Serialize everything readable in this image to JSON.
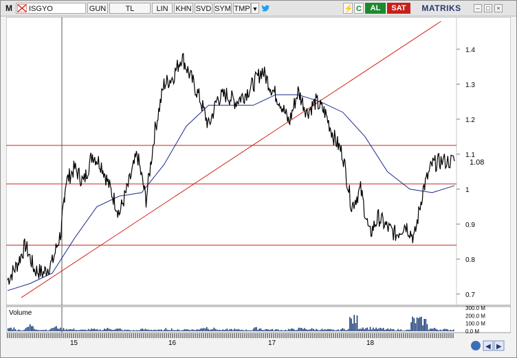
{
  "toolbar": {
    "logo": "M",
    "symbol": "ISGYO",
    "buttons": [
      "GUN",
      "TL",
      "LIN",
      "KHN",
      "SVD",
      "SYM",
      "TMP"
    ],
    "buy_label": "AL",
    "sell_label": "SAT",
    "brand": "MATRIKS",
    "icons": [
      "arrow-down-icon",
      "twitter-icon",
      "lightning-icon",
      "refresh-icon"
    ],
    "window_icons": [
      "minimize-icon",
      "restore-icon",
      "close-icon"
    ]
  },
  "price_panel": {
    "y_ticks": [
      "1.4",
      "1.3",
      "1.2",
      "1.1",
      "1",
      "0.9",
      "0.8",
      "0.7"
    ],
    "current_price": "1.08",
    "colors": {
      "price": "#000000",
      "moving_average": "#1a2a8c",
      "trendline": "#d0201a",
      "levels": "#c8261e",
      "axis_price_label": "#000000"
    }
  },
  "volume_panel": {
    "label": "Volume",
    "y_ticks": [
      "300.0 M",
      "200.0 M",
      "100.0 M",
      "0.0 M"
    ],
    "bar_color": "#1a3c7a"
  },
  "time_axis": {
    "labels": [
      "15",
      "16",
      "17",
      "18"
    ]
  },
  "chart_data": {
    "type": "line",
    "ylim": [
      0.68,
      1.48
    ],
    "x_labels": [
      "15",
      "16",
      "17",
      "18"
    ],
    "horizontal_levels": [
      1.125,
      1.015,
      0.84
    ],
    "trendline": {
      "start": {
        "x": 0.0,
        "y": 0.69
      },
      "end": {
        "x": 0.97,
        "y": 1.48
      }
    },
    "price": {
      "x": [
        0.0,
        0.02,
        0.04,
        0.06,
        0.08,
        0.1,
        0.12,
        0.13,
        0.15,
        0.17,
        0.19,
        0.21,
        0.23,
        0.25,
        0.27,
        0.29,
        0.31,
        0.33,
        0.35,
        0.37,
        0.39,
        0.41,
        0.43,
        0.45,
        0.47,
        0.49,
        0.51,
        0.53,
        0.55,
        0.57,
        0.59,
        0.61,
        0.63,
        0.65,
        0.67,
        0.69,
        0.71,
        0.73,
        0.75,
        0.77,
        0.79,
        0.81,
        0.83,
        0.85,
        0.87,
        0.89,
        0.91,
        0.93,
        0.95,
        0.97,
        1.0
      ],
      "y": [
        0.74,
        0.78,
        0.84,
        0.77,
        0.76,
        0.79,
        0.88,
        1.02,
        1.06,
        1.02,
        1.1,
        1.07,
        1.0,
        0.93,
        1.01,
        1.1,
        0.97,
        1.17,
        1.3,
        1.32,
        1.38,
        1.32,
        1.26,
        1.18,
        1.26,
        1.27,
        1.25,
        1.27,
        1.3,
        1.34,
        1.29,
        1.25,
        1.19,
        1.28,
        1.22,
        1.25,
        1.22,
        1.15,
        1.1,
        0.95,
        1.0,
        0.87,
        0.92,
        0.89,
        0.87,
        0.9,
        0.86,
        1.0,
        1.07,
        1.08,
        1.08
      ]
    },
    "moving_average": {
      "x": [
        0.0,
        0.05,
        0.1,
        0.15,
        0.2,
        0.25,
        0.3,
        0.35,
        0.4,
        0.45,
        0.5,
        0.55,
        0.6,
        0.65,
        0.7,
        0.75,
        0.8,
        0.85,
        0.9,
        0.95,
        1.0
      ],
      "y": [
        0.71,
        0.73,
        0.76,
        0.86,
        0.95,
        0.98,
        0.99,
        1.07,
        1.18,
        1.24,
        1.24,
        1.24,
        1.27,
        1.27,
        1.25,
        1.22,
        1.15,
        1.05,
        1.0,
        0.99,
        1.01
      ]
    },
    "volume_mil": [
      50,
      20,
      80,
      30,
      25,
      60,
      40,
      30,
      20,
      30,
      25,
      40,
      35,
      20,
      15,
      30,
      25,
      20,
      35,
      20,
      30,
      25,
      60,
      40,
      20,
      30,
      25,
      20,
      45,
      30,
      25,
      20,
      30,
      40,
      35,
      30,
      25,
      20,
      35,
      180,
      60,
      50,
      40,
      30,
      25,
      20,
      170,
      160,
      40,
      30,
      25
    ]
  }
}
